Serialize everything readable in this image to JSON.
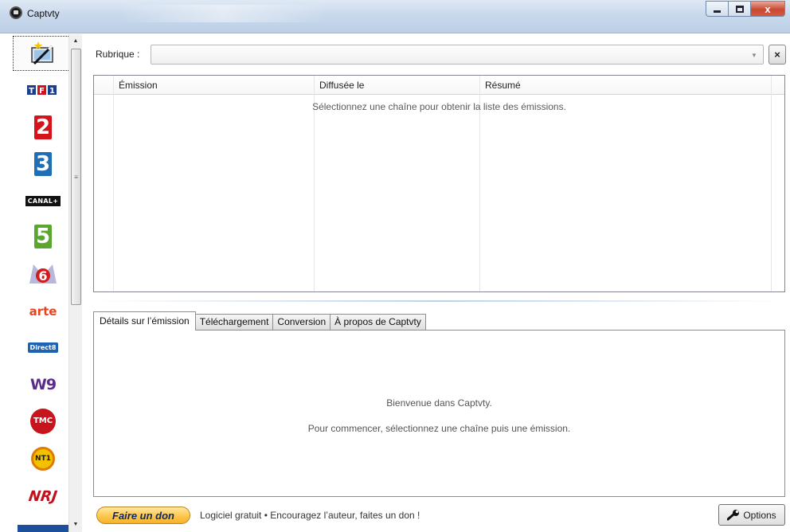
{
  "window": {
    "title": "Captvty",
    "close_glyph": "x"
  },
  "sidebar": {
    "channels": [
      {
        "name": "all-channels",
        "label": "",
        "selected": true
      },
      {
        "name": "tf1",
        "label": "TF1"
      },
      {
        "name": "france2",
        "label": "2"
      },
      {
        "name": "france3",
        "label": "3"
      },
      {
        "name": "canal-plus",
        "label": "CANAL+"
      },
      {
        "name": "france5",
        "label": "5"
      },
      {
        "name": "m6",
        "label": "6"
      },
      {
        "name": "arte",
        "label": "arte"
      },
      {
        "name": "direct8",
        "label": "Direct8"
      },
      {
        "name": "w9",
        "label": "W9"
      },
      {
        "name": "tmc",
        "label": "TMC"
      },
      {
        "name": "nt1",
        "label": "NT1"
      },
      {
        "name": "nrj12",
        "label": "NRJ"
      }
    ],
    "colors": {
      "tf1": "#1b3d8f",
      "tf1_red": "#d3121b",
      "france2": "#d6131b",
      "france3": "#1e6fb5",
      "france5": "#5aa630",
      "m6": "#b7b9dc",
      "arte": "#e8451f",
      "direct8": "#1d62b3",
      "w9": "#5b2b8c",
      "tmc": "#c8151d",
      "nt1": "#f2c200",
      "nrj": "#c2101b"
    }
  },
  "rubrique": {
    "label": "Rubrique :",
    "value": "",
    "clear_glyph": "×"
  },
  "emissions_list": {
    "columns": [
      "Émission",
      "Diffusée le",
      "Résumé"
    ],
    "empty_message": "Sélectionnez une chaîne pour obtenir la liste des émissions."
  },
  "tabs": [
    {
      "label": "Détails sur l’émission",
      "active": true
    },
    {
      "label": "Téléchargement"
    },
    {
      "label": "Conversion"
    },
    {
      "label": "À propos de Captvty"
    }
  ],
  "details": {
    "welcome": "Bienvenue dans Captvty.",
    "instructions": "Pour commencer, sélectionnez une chaîne puis une émission."
  },
  "footer": {
    "donate_label": "Faire un don",
    "message": "Logiciel gratuit • Encouragez l’auteur, faites un don !",
    "options_label": "Options",
    "options_icon": "wrench-icon"
  }
}
